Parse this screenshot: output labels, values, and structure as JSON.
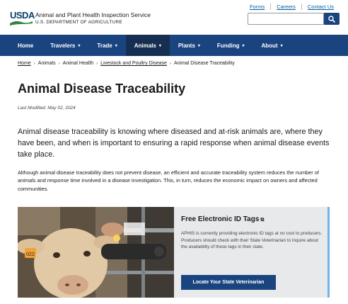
{
  "header": {
    "logo_text": "USDA",
    "agency_name": "Animal and Plant Health Inspection Service",
    "department": "U.S. DEPARTMENT OF AGRICULTURE",
    "utility_links": [
      "Forms",
      "Careers",
      "Contact Us"
    ],
    "search_value": ""
  },
  "nav": {
    "items": [
      {
        "label": "Home",
        "caret": ""
      },
      {
        "label": "Travelers",
        "caret": "▾"
      },
      {
        "label": "Trade",
        "caret": "▾"
      },
      {
        "label": "Animals",
        "caret": "▾"
      },
      {
        "label": "Plants",
        "caret": "▾"
      },
      {
        "label": "Funding",
        "caret": "▾"
      },
      {
        "label": "About",
        "caret": "▾"
      }
    ],
    "active": "Animals"
  },
  "breadcrumb": [
    "Home",
    "Animals",
    "Animal Health",
    "Livestock and Poultry Disease",
    "Animal Disease Traceability"
  ],
  "page": {
    "title": "Animal Disease Traceability",
    "last_modified": "Last Modified: May 02, 2024",
    "lead": "Animal disease traceability is knowing where diseased and at-risk animals are, where they have been, and when is important to ensuring a rapid response when animal disease events take place.",
    "body": "Although animal disease traceability does not prevent disease, an efficient and accurate traceability system reduces the number of animals and response time involved in a disease investigation. This, in turn, reduces the economic impact on owners and affected communities."
  },
  "feature": {
    "title": "Free Electronic ID Tags",
    "text": "APHIS is currently providing electronic ID tags at no cost to producers. Producers should check with their State Veterinarian to inquire about the availability of these tags in their state.",
    "button_label": "Locate Your State Veterinarian",
    "ear_tag_number": "022"
  },
  "colors": {
    "nav_bg": "#1a4480",
    "nav_active": "#162e51",
    "link": "#005ea2",
    "card_accent": "#73b3e7"
  },
  "icons": {
    "search": "search-icon",
    "external": "external-link-icon",
    "caret": "chevron-down-icon"
  }
}
